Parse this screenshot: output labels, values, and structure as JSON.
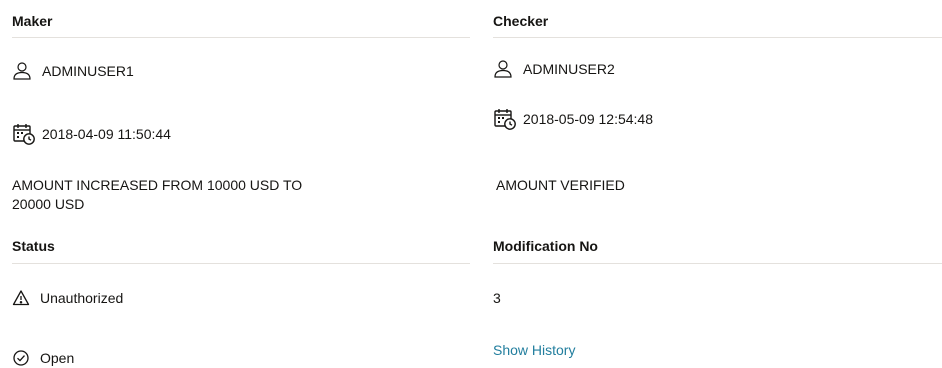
{
  "maker": {
    "title": "Maker",
    "user": "ADMINUSER1",
    "timestamp": "2018-04-09 11:50:44",
    "remarks_line1": "AMOUNT INCREASED FROM 10000 USD TO",
    "remarks_line2": "20000 USD"
  },
  "checker": {
    "title": "Checker",
    "user": "ADMINUSER2",
    "timestamp": "2018-05-09 12:54:48",
    "remarks": "AMOUNT VERIFIED"
  },
  "status": {
    "title": "Status",
    "auth_status": "Unauthorized",
    "record_status": "Open"
  },
  "modification": {
    "title": "Modification No",
    "number": "3",
    "history_link": "Show History"
  },
  "icons": {
    "user": "user-icon",
    "calendar": "calendar-clock-icon",
    "warning": "warning-triangle-icon",
    "check": "check-circle-icon"
  }
}
